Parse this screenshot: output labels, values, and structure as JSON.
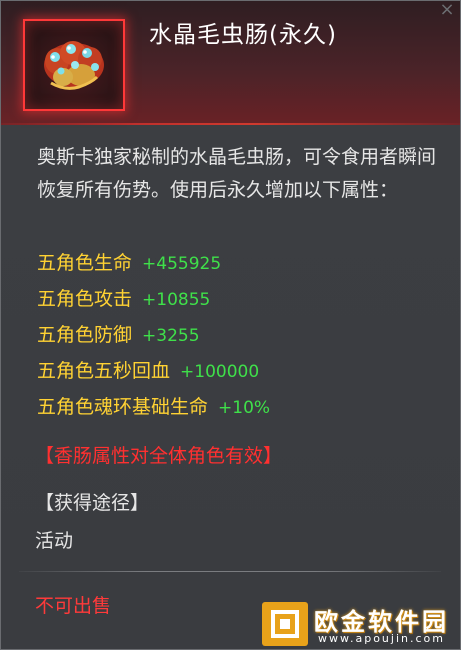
{
  "item": {
    "title": "水晶毛虫肠(永久)",
    "icon": "crystal-caterpillar-sausage-icon",
    "description": "奥斯卡独家秘制的水晶毛虫肠，可令食用者瞬间恢复所有伤势。使用后永久增加以下属性：",
    "stats": [
      {
        "label": "五角色生命",
        "value": "+455925"
      },
      {
        "label": "五角色攻击",
        "value": "+10855"
      },
      {
        "label": "五角色防御",
        "value": "+3255"
      },
      {
        "label": "五角色五秒回血",
        "value": "+100000"
      },
      {
        "label": "五角色魂环基础生命",
        "value": "+10%"
      }
    ],
    "notice": "【香肠属性对全体角色有效】",
    "source_title": "【获得途径】",
    "source_value": "活动",
    "sell_status": "不可出售"
  },
  "watermark": {
    "name": "欧金软件园",
    "url": "www.apoujin.com"
  },
  "colors": {
    "stat_label": "#ffd233",
    "stat_value": "#3fe04a",
    "warning": "#ff3030",
    "icon_frame": "#ff3838"
  }
}
